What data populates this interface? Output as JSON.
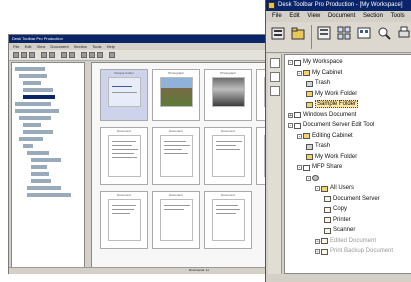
{
  "front_window": {
    "title": "Desk Toolbar Pro Production - [My Workspace]",
    "menu": [
      "File",
      "Edit",
      "View",
      "Document",
      "Section",
      "Tools"
    ],
    "tree": [
      {
        "label": "My Workspace",
        "icon": "workspace-icon",
        "depth": 0,
        "toggle": "-"
      },
      {
        "label": "My Cabinet",
        "icon": "cabinet-icon",
        "depth": 1,
        "toggle": "-"
      },
      {
        "label": "Trash",
        "icon": "trash-icon",
        "depth": 2
      },
      {
        "label": "My Work Folder",
        "icon": "folder-icon",
        "depth": 2
      },
      {
        "label": "Sample Folder",
        "icon": "folder-icon",
        "depth": 2,
        "selected": true
      },
      {
        "label": "Windows Document",
        "icon": "documents-icon",
        "depth": 0,
        "toggle": "+"
      },
      {
        "label": "Document Server Edit Tool",
        "icon": "server-icon",
        "depth": 0,
        "toggle": "-"
      },
      {
        "label": "Editing Cabinet",
        "icon": "cabinet-icon",
        "depth": 1,
        "toggle": "-"
      },
      {
        "label": "Trash",
        "icon": "trash-icon",
        "depth": 2
      },
      {
        "label": "My Work Folder",
        "icon": "folder-icon",
        "depth": 2
      },
      {
        "label": "MFP Share",
        "icon": "printer-icon",
        "depth": 1,
        "toggle": "-"
      },
      {
        "label": "",
        "icon": "gear-icon",
        "depth": 2,
        "toggle": "-"
      },
      {
        "label": "All Users",
        "icon": "users-icon",
        "depth": 3,
        "toggle": "-"
      },
      {
        "label": "Document Server",
        "icon": "document-icon",
        "depth": 4
      },
      {
        "label": "Copy",
        "icon": "document-icon",
        "depth": 4
      },
      {
        "label": "Printer",
        "icon": "document-icon",
        "depth": 4
      },
      {
        "label": "Scanner",
        "icon": "document-icon",
        "depth": 4
      },
      {
        "label": "Edited Document",
        "icon": "document-icon",
        "depth": 3,
        "toggle": "+",
        "faded": true
      },
      {
        "label": "Print Backup Document",
        "icon": "document-icon",
        "depth": 3,
        "toggle": "+",
        "faded": true
      }
    ]
  },
  "back_window": {
    "title": "Desk Toolbar Pro Production",
    "menu": [
      "File",
      "Edit",
      "View",
      "Document",
      "Section",
      "Tools",
      "Help"
    ],
    "thumb_captions": [
      "Sample Folder",
      "Photograph",
      "Photograph",
      "Document",
      "Document",
      "Document",
      "Document",
      "Document",
      "Document",
      "Document",
      "Document"
    ],
    "status": "Documents: 11"
  },
  "colors": {
    "title_bar": "#0a246a",
    "selection": "#ffe6a8",
    "window_face": "#d4d0c8"
  }
}
